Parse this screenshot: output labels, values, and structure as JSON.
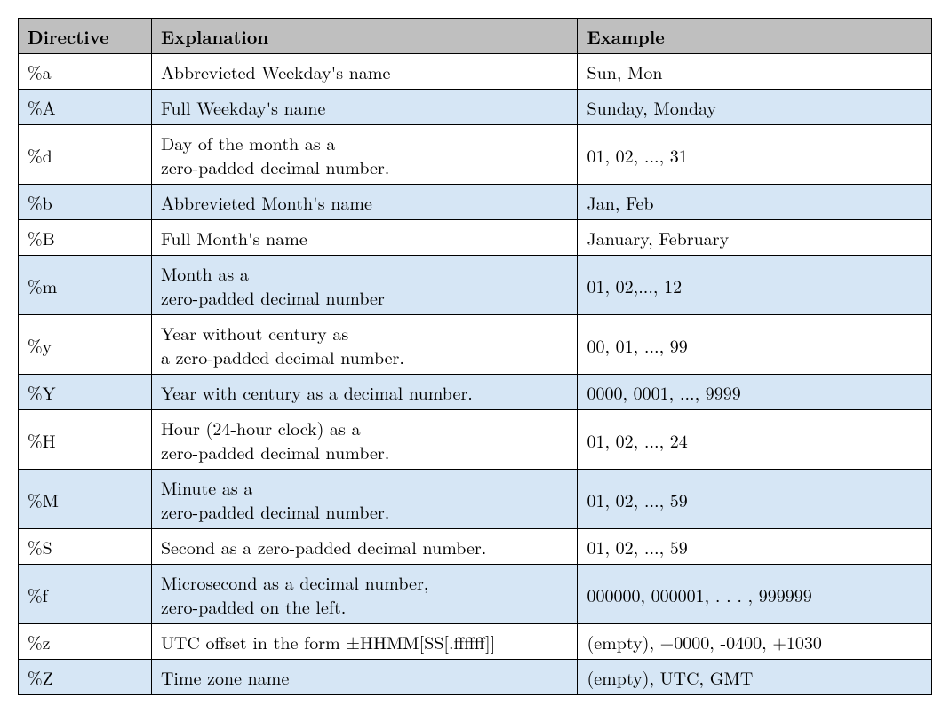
{
  "table": {
    "headers": [
      "Directive",
      "Explanation",
      "Example"
    ],
    "rows": [
      {
        "shade": false,
        "directive": "%a",
        "explanation": "Abbrevieted Weekday's name",
        "example": "Sun, Mon"
      },
      {
        "shade": true,
        "directive": "%A",
        "explanation": "Full Weekday's name",
        "example": "Sunday, Monday"
      },
      {
        "shade": false,
        "directive": "%d",
        "explanation": "Day of the month as a\nzero-padded decimal number.",
        "example": "01, 02, ..., 31"
      },
      {
        "shade": true,
        "directive": "%b",
        "explanation": "Abbrevieted Month's name",
        "example": "Jan, Feb"
      },
      {
        "shade": false,
        "directive": "%B",
        "explanation": "Full Month's name",
        "example": "January, February"
      },
      {
        "shade": true,
        "directive": "%m",
        "explanation": "Month as a\nzero-padded decimal number",
        "example": "01, 02,..., 12"
      },
      {
        "shade": false,
        "directive": "%y",
        "explanation": "Year without century as\na zero-padded decimal number.",
        "example": "00, 01, ..., 99"
      },
      {
        "shade": true,
        "directive": "%Y",
        "explanation": "Year with century as a decimal number.",
        "example": "0000, 0001, ..., 9999"
      },
      {
        "shade": false,
        "directive": "%H",
        "explanation": "Hour (24-hour clock) as a\nzero-padded decimal number.",
        "example": "01, 02, ..., 24"
      },
      {
        "shade": true,
        "directive": "%M",
        "explanation": "Minute as a\nzero-padded decimal number.",
        "example": "01, 02, ..., 59"
      },
      {
        "shade": false,
        "directive": "%S",
        "explanation": "Second as a zero-padded decimal number.",
        "example": "01, 02, ..., 59"
      },
      {
        "shade": true,
        "directive": "%f",
        "explanation": "Microsecond as a decimal number,\nzero-padded on the left.",
        "example": "000000, 000001, . . . , 999999"
      },
      {
        "shade": false,
        "directive": "%z",
        "explanation": "UTC offset in the form ±HHMM[SS[.ffffff]]",
        "example": "(empty), +0000, -0400, +1030"
      },
      {
        "shade": true,
        "directive": "%Z",
        "explanation": "Time zone name",
        "example": "(empty), UTC, GMT"
      }
    ]
  }
}
